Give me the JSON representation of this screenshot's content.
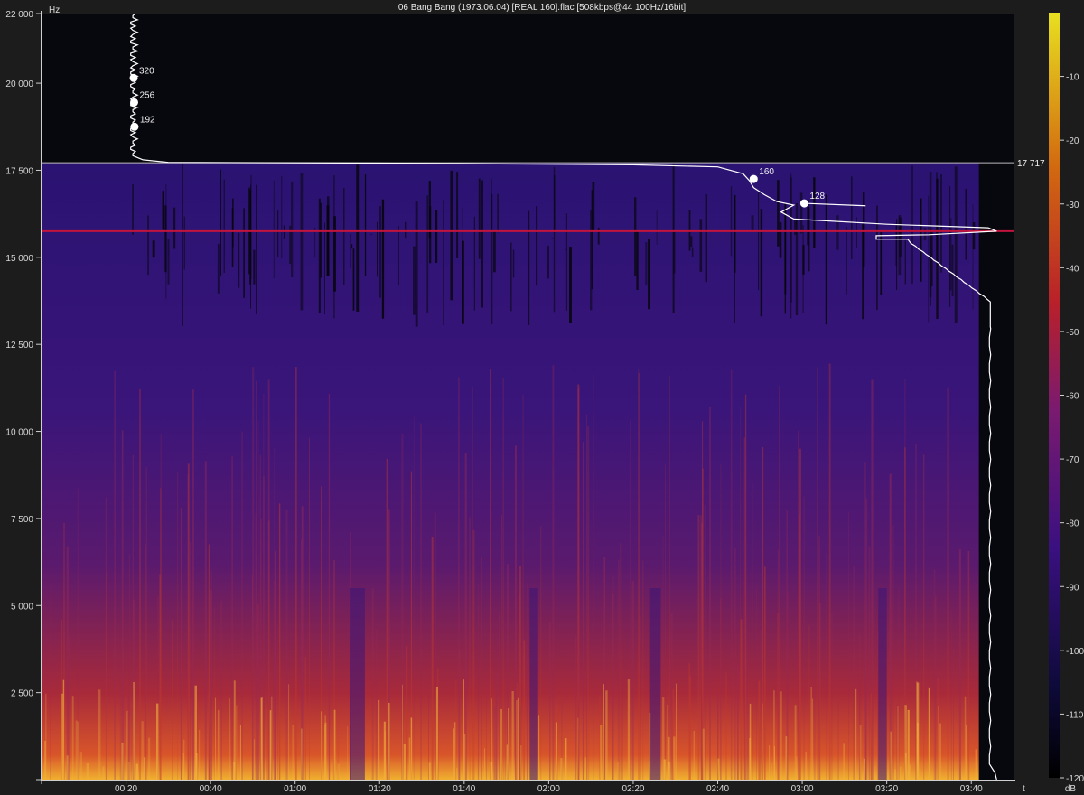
{
  "window": {
    "title": "06 Bang Bang (1973.06.04) [REAL 160].flac [508kbps@44 100Hz/16bit]"
  },
  "colors": {
    "background": "#1c1c1c",
    "empty_region": "#07070e",
    "low_level": "#2a0d6e",
    "mid_level": "#b02626",
    "high_level": "#f6c23a",
    "cutoff_line": "#bfbfbf",
    "marker_line": "#c0143c",
    "profile_line": "#ffffff"
  },
  "chart_data": {
    "type": "heatmap",
    "title": "06 Bang Bang (1973.06.04) [REAL 160].flac [508kbps@44 100Hz/16bit]",
    "xlabel": "t",
    "ylabel": "Hz",
    "x_range_seconds": [
      0,
      230
    ],
    "y_range_hz": [
      0,
      22000
    ],
    "x_ticks": [
      {
        "seconds": 20,
        "label": "00:20"
      },
      {
        "seconds": 40,
        "label": "00:40"
      },
      {
        "seconds": 60,
        "label": "01:00"
      },
      {
        "seconds": 80,
        "label": "01:20"
      },
      {
        "seconds": 100,
        "label": "01:40"
      },
      {
        "seconds": 120,
        "label": "02:00"
      },
      {
        "seconds": 140,
        "label": "02:20"
      },
      {
        "seconds": 160,
        "label": "02:40"
      },
      {
        "seconds": 180,
        "label": "03:00"
      },
      {
        "seconds": 200,
        "label": "03:20"
      },
      {
        "seconds": 220,
        "label": "03:40"
      }
    ],
    "y_ticks": [
      {
        "hz": 2500,
        "label": "2 500"
      },
      {
        "hz": 5000,
        "label": "5 000"
      },
      {
        "hz": 7500,
        "label": "7 500"
      },
      {
        "hz": 10000,
        "label": "10 000"
      },
      {
        "hz": 12500,
        "label": "12 500"
      },
      {
        "hz": 15000,
        "label": "15 000"
      },
      {
        "hz": 17500,
        "label": "17 500"
      },
      {
        "hz": 20000,
        "label": "20 000"
      },
      {
        "hz": 22000,
        "label": "22 000"
      }
    ],
    "cutoff": {
      "hz": 17717,
      "label": "17 717"
    },
    "marker_line_hz": 15750,
    "bitrate_markers": [
      {
        "label": "320",
        "seconds": 21.8,
        "hz": 20150
      },
      {
        "label": "256",
        "seconds": 21.9,
        "hz": 19450
      },
      {
        "label": "192",
        "seconds": 22.0,
        "hz": 18750
      },
      {
        "label": "160",
        "seconds": 168.5,
        "hz": 17250
      },
      {
        "label": "128",
        "seconds": 180.5,
        "hz": 16550
      }
    ],
    "colorbar": {
      "unit": "dB",
      "range_db": [
        -120,
        0
      ],
      "ticks": [
        {
          "db": -10,
          "label": "-10"
        },
        {
          "db": -20,
          "label": "-20"
        },
        {
          "db": -30,
          "label": "-30"
        },
        {
          "db": -40,
          "label": "-40"
        },
        {
          "db": -50,
          "label": "-50"
        },
        {
          "db": -60,
          "label": "-60"
        },
        {
          "db": -70,
          "label": "-70"
        },
        {
          "db": -80,
          "label": "-80"
        },
        {
          "db": -90,
          "label": "-90"
        },
        {
          "db": -100,
          "label": "-100"
        },
        {
          "db": -110,
          "label": "-110"
        },
        {
          "db": -120,
          "label": "-120"
        }
      ]
    },
    "grid": false
  }
}
